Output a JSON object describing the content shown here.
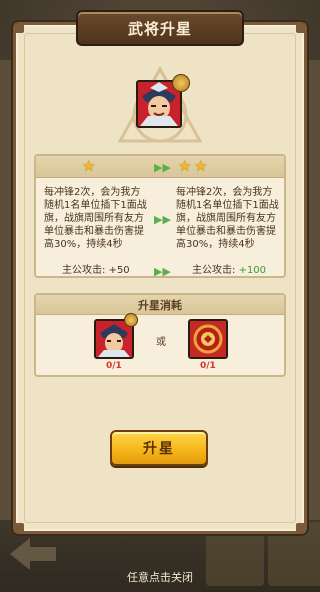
{
  "dialog": {
    "title": "武将升星"
  },
  "comparison": {
    "current": {
      "stars": 1,
      "description": "每冲锋2次，会为我方随机1名单位插下1面战旗，战旗周围所有友方单位暴击和暴击伤害提高30%，持续4秒",
      "attack_label": "主公攻击: ",
      "attack_value": "+50"
    },
    "next": {
      "stars": 2,
      "description": "每冲锋2次，会为我方随机1名单位插下1面战旗，战旗周围所有友方单位暴击和暴击伤害提高30%，持续4秒",
      "attack_label": "主公攻击: ",
      "attack_value": "+100"
    }
  },
  "cost": {
    "header": "升星消耗",
    "or_label": "或",
    "items": [
      {
        "icon": "hero-card-icon",
        "count": "0/1"
      },
      {
        "icon": "red-coin-icon",
        "count": "0/1"
      }
    ]
  },
  "actions": {
    "upgrade_label": "升星",
    "close_hint": "任意点击关闭"
  },
  "colors": {
    "panel_bg": "#efe3c6",
    "button": "#f5b418",
    "bonus_green": "#3d9c34",
    "count_red": "#d03a2b"
  }
}
